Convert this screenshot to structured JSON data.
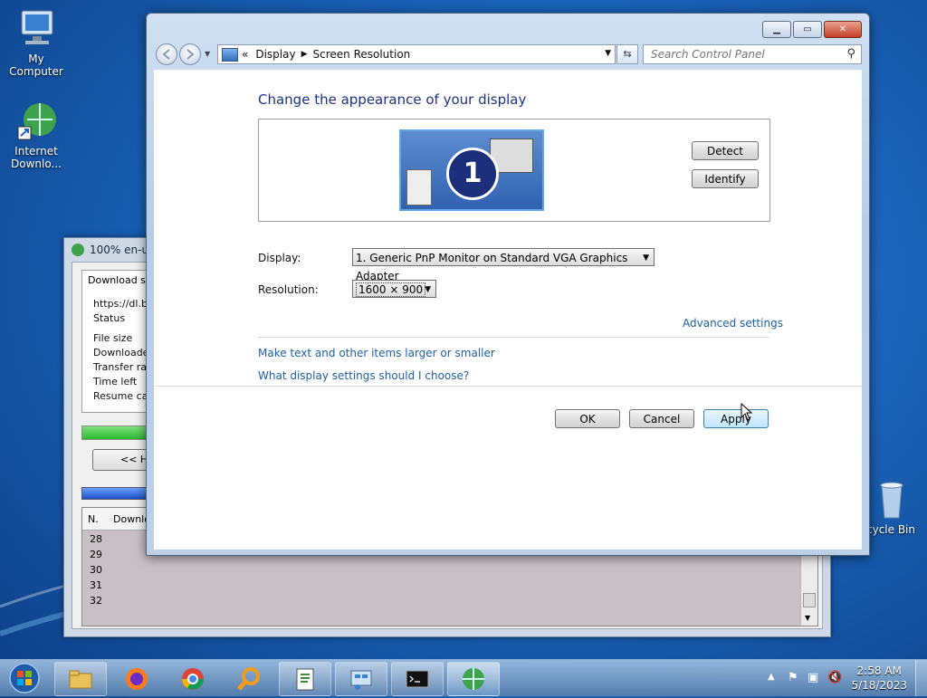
{
  "desktop": {
    "icons": [
      {
        "label": "My Computer"
      },
      {
        "label": "Internet Downlo..."
      },
      {
        "label": "cycle Bin"
      }
    ]
  },
  "idm": {
    "title": "100% en-us",
    "info_header": "Download sta",
    "rows": [
      "https://dl.bo",
      "Status",
      "File size",
      "Downloaded",
      "Transfer rat",
      "Time left",
      "Resume cap"
    ],
    "hide_button": "<< Hi",
    "progress_percent": 100,
    "list_headers": [
      "N.",
      "Downlo"
    ],
    "list_rows": [
      "28",
      "29",
      "30",
      "31",
      "32"
    ]
  },
  "window": {
    "breadcrumb": [
      "Display",
      "Screen Resolution"
    ],
    "breadcrumb_prefix": "«",
    "search_placeholder": "Search Control Panel",
    "page_title": "Change the appearance of your display",
    "monitor_number": "1",
    "detect_label": "Detect",
    "identify_label": "Identify",
    "display_label": "Display:",
    "display_value": "1. Generic PnP Monitor on Standard VGA Graphics Adapter",
    "resolution_label": "Resolution:",
    "resolution_value": "1600 × 900",
    "advanced_link": "Advanced settings",
    "link_text_size": "Make text and other items larger or smaller",
    "link_help": "What display settings should I choose?",
    "ok_label": "OK",
    "cancel_label": "Cancel",
    "apply_label": "Apply"
  },
  "taskbar": {
    "time": "2:58 AM",
    "date": "5/18/2023"
  },
  "icons": {
    "start": "windows-orb-icon",
    "explorer": "folder-icon",
    "firefox": "firefox-icon",
    "chrome": "chrome-icon",
    "search_tool": "magnifier-icon",
    "notepad": "notepad-icon",
    "control_panel": "control-panel-icon",
    "cmd": "command-prompt-icon",
    "idm": "idm-globe-icon"
  },
  "colors": {
    "link": "#1c5fa8",
    "title": "#1e3287",
    "close_button": "#c6402a"
  }
}
